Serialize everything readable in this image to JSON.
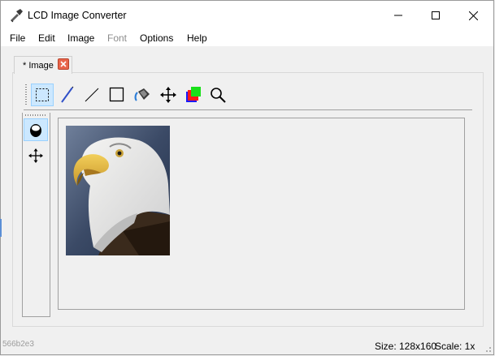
{
  "window": {
    "title": "LCD Image Converter",
    "icon": "lcd-app-icon"
  },
  "menu": {
    "items": [
      {
        "label": "File",
        "enabled": true
      },
      {
        "label": "Edit",
        "enabled": true
      },
      {
        "label": "Image",
        "enabled": true
      },
      {
        "label": "Font",
        "enabled": false
      },
      {
        "label": "Options",
        "enabled": true
      },
      {
        "label": "Help",
        "enabled": true
      }
    ]
  },
  "tabs": [
    {
      "label": "* Image",
      "active": true
    }
  ],
  "toolbar": {
    "tools": [
      {
        "name": "select-rect-icon",
        "active": true
      },
      {
        "name": "pen-icon",
        "active": false
      },
      {
        "name": "line-icon",
        "active": false
      },
      {
        "name": "rectangle-icon",
        "active": false
      },
      {
        "name": "fill-bucket-icon",
        "active": false
      },
      {
        "name": "move-icon",
        "active": false
      },
      {
        "name": "color-picker-icon",
        "active": false
      },
      {
        "name": "zoom-icon",
        "active": false
      }
    ]
  },
  "side_tools": [
    {
      "name": "select-mode-icon",
      "active": true
    },
    {
      "name": "move-selection-icon",
      "active": false
    }
  ],
  "status": {
    "size": "Size: 128x160",
    "scale": "Scale: 1x"
  },
  "background_edge_text": "566b2e3",
  "colors": {
    "accent": "#cce8ff",
    "accent_border": "#99d1ff",
    "tab_close": "#e8654b",
    "pen_blue": "#3050c8"
  }
}
